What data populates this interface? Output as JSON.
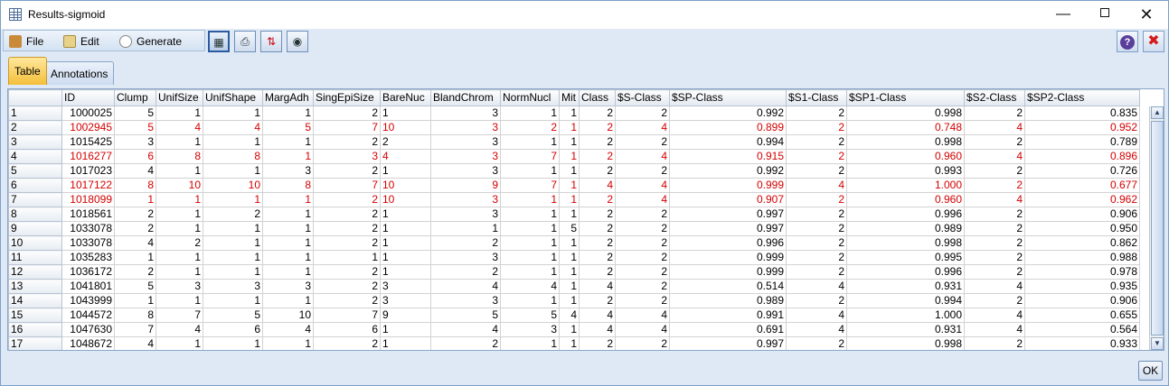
{
  "window": {
    "title": "Results-sigmoid"
  },
  "menu": {
    "file": "File",
    "edit": "Edit",
    "generate": "Generate"
  },
  "tabs": {
    "table": "Table",
    "annotations": "Annotations"
  },
  "table": {
    "columns": [
      "",
      "ID",
      "Clump",
      "UnifSize",
      "UnifShape",
      "MargAdh",
      "SingEpiSize",
      "BareNuc",
      "BlandChrom",
      "NormNucl",
      "Mit",
      "Class",
      "$S-Class",
      "$SP-Class",
      "$S1-Class",
      "$SP1-Class",
      "$S2-Class",
      "$SP2-Class"
    ],
    "rows": [
      [
        "1",
        "1000025",
        "5",
        "1",
        "1",
        "1",
        "2",
        "1",
        "3",
        "1",
        "1",
        "2",
        "2",
        "0.992",
        "2",
        "0.998",
        "2",
        "0.835"
      ],
      [
        "2",
        "1002945",
        "5",
        "4",
        "4",
        "5",
        "7",
        "10",
        "3",
        "2",
        "1",
        "2",
        "4",
        "0.899",
        "2",
        "0.748",
        "4",
        "0.952"
      ],
      [
        "3",
        "1015425",
        "3",
        "1",
        "1",
        "1",
        "2",
        "2",
        "3",
        "1",
        "1",
        "2",
        "2",
        "0.994",
        "2",
        "0.998",
        "2",
        "0.789"
      ],
      [
        "4",
        "1016277",
        "6",
        "8",
        "8",
        "1",
        "3",
        "4",
        "3",
        "7",
        "1",
        "2",
        "4",
        "0.915",
        "2",
        "0.960",
        "4",
        "0.896"
      ],
      [
        "5",
        "1017023",
        "4",
        "1",
        "1",
        "3",
        "2",
        "1",
        "3",
        "1",
        "1",
        "2",
        "2",
        "0.992",
        "2",
        "0.993",
        "2",
        "0.726"
      ],
      [
        "6",
        "1017122",
        "8",
        "10",
        "10",
        "8",
        "7",
        "10",
        "9",
        "7",
        "1",
        "4",
        "4",
        "0.999",
        "4",
        "1.000",
        "2",
        "0.677"
      ],
      [
        "7",
        "1018099",
        "1",
        "1",
        "1",
        "1",
        "2",
        "10",
        "3",
        "1",
        "1",
        "2",
        "4",
        "0.907",
        "2",
        "0.960",
        "4",
        "0.962"
      ],
      [
        "8",
        "1018561",
        "2",
        "1",
        "2",
        "1",
        "2",
        "1",
        "3",
        "1",
        "1",
        "2",
        "2",
        "0.997",
        "2",
        "0.996",
        "2",
        "0.906"
      ],
      [
        "9",
        "1033078",
        "2",
        "1",
        "1",
        "1",
        "2",
        "1",
        "1",
        "1",
        "5",
        "2",
        "2",
        "0.997",
        "2",
        "0.989",
        "2",
        "0.950"
      ],
      [
        "10",
        "1033078",
        "4",
        "2",
        "1",
        "1",
        "2",
        "1",
        "2",
        "1",
        "1",
        "2",
        "2",
        "0.996",
        "2",
        "0.998",
        "2",
        "0.862"
      ],
      [
        "11",
        "1035283",
        "1",
        "1",
        "1",
        "1",
        "1",
        "1",
        "3",
        "1",
        "1",
        "2",
        "2",
        "0.999",
        "2",
        "0.995",
        "2",
        "0.988"
      ],
      [
        "12",
        "1036172",
        "2",
        "1",
        "1",
        "1",
        "2",
        "1",
        "2",
        "1",
        "1",
        "2",
        "2",
        "0.999",
        "2",
        "0.996",
        "2",
        "0.978"
      ],
      [
        "13",
        "1041801",
        "5",
        "3",
        "3",
        "3",
        "2",
        "3",
        "4",
        "4",
        "1",
        "4",
        "2",
        "0.514",
        "4",
        "0.931",
        "4",
        "0.935"
      ],
      [
        "14",
        "1043999",
        "1",
        "1",
        "1",
        "1",
        "2",
        "3",
        "3",
        "1",
        "1",
        "2",
        "2",
        "0.989",
        "2",
        "0.994",
        "2",
        "0.906"
      ],
      [
        "15",
        "1044572",
        "8",
        "7",
        "5",
        "10",
        "7",
        "9",
        "5",
        "5",
        "4",
        "4",
        "4",
        "0.991",
        "4",
        "1.000",
        "4",
        "0.655"
      ],
      [
        "16",
        "1047630",
        "7",
        "4",
        "6",
        "4",
        "6",
        "1",
        "4",
        "3",
        "1",
        "4",
        "4",
        "0.691",
        "4",
        "0.931",
        "4",
        "0.564"
      ],
      [
        "17",
        "1048672",
        "4",
        "1",
        "1",
        "1",
        "2",
        "1",
        "2",
        "1",
        "1",
        "2",
        "2",
        "0.997",
        "2",
        "0.998",
        "2",
        "0.933"
      ]
    ],
    "highlighted_rows": [
      1,
      3,
      5,
      6
    ],
    "highlight_color": "#d40000"
  },
  "buttons": {
    "ok": "OK"
  },
  "icons": {
    "app": "table-icon",
    "file": "file-icon",
    "edit": "edit-icon",
    "generate": "generate-icon",
    "tb1": "table-insert-icon",
    "tb2": "print-icon",
    "tb3": "sort-icon",
    "tb4": "binoculars-icon",
    "help": "help-icon",
    "close": "close-icon"
  }
}
